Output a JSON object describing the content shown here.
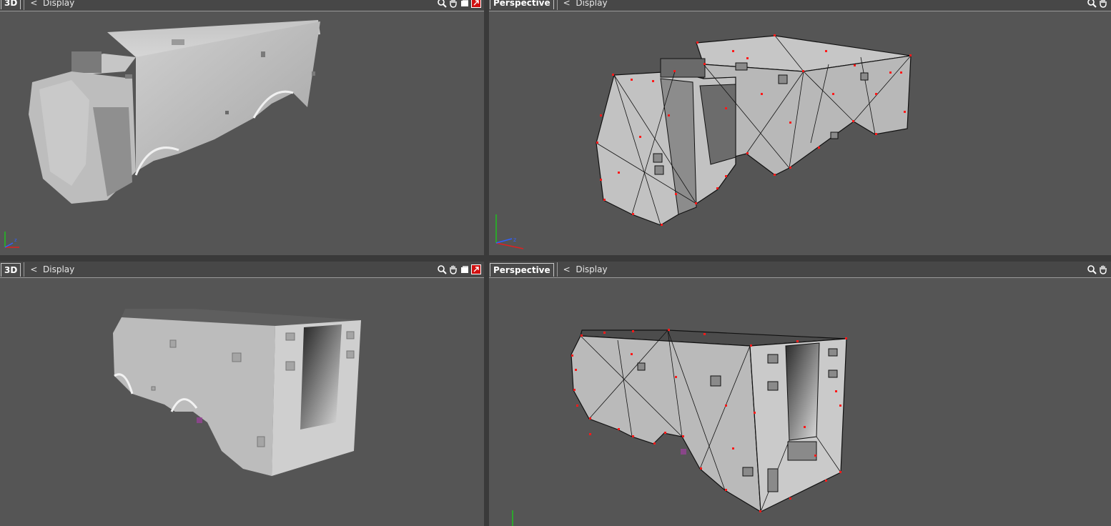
{
  "viewports": [
    {
      "id": "top-left",
      "view_label": "3D",
      "display_label": "<  Display",
      "mode": "shaded"
    },
    {
      "id": "top-right",
      "view_label": "Perspective",
      "display_label": "<  Display",
      "mode": "wireframe-vertices"
    },
    {
      "id": "bottom-left",
      "view_label": "3D",
      "display_label": "<  Display",
      "mode": "shaded"
    },
    {
      "id": "bottom-right",
      "view_label": "Perspective",
      "display_label": "<  Display",
      "mode": "wireframe-vertices"
    }
  ],
  "toolbar_icons": [
    "zoom-icon",
    "pan-hand-icon",
    "frame-icon",
    "maximize-icon"
  ],
  "axis_labels": {
    "x": "x",
    "y": "y",
    "z": "z"
  },
  "colors": {
    "viewport_bg": "#555555",
    "mesh_gray": "#bcbcbc",
    "wire": "#111111",
    "vertex": "#ff1a1a",
    "axis_x": "#e02020",
    "axis_y": "#20c020",
    "axis_z": "#3060ff"
  }
}
